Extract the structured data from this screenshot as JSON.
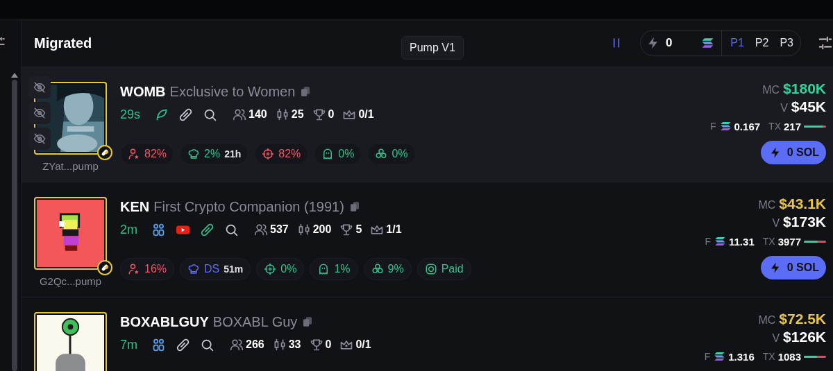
{
  "header": {
    "title": "Migrated",
    "tooltip": "Pump V1",
    "quick_buy": {
      "amount": "0"
    },
    "presets": [
      {
        "label": "P1",
        "selected": true
      },
      {
        "label": "P2",
        "selected": false
      },
      {
        "label": "P3",
        "selected": false
      }
    ]
  },
  "rows": [
    {
      "hovered": true,
      "ticker": "WOMB",
      "name": "Exclusive to Women",
      "address": "ZYat...pump",
      "age": "29s",
      "links": [
        {
          "kind": "feather",
          "highlighted": true
        },
        {
          "kind": "link",
          "highlighted": false
        },
        {
          "kind": "search",
          "highlighted": false
        }
      ],
      "stats": [
        {
          "kind": "holders",
          "value": "140"
        },
        {
          "kind": "candles",
          "value": "25"
        },
        {
          "kind": "trophy",
          "value": "0"
        },
        {
          "kind": "crown",
          "value": "0/1"
        }
      ],
      "badges": [
        {
          "kind": "top_holders",
          "value": "82%",
          "color": "#f0566a"
        },
        {
          "kind": "dev",
          "value": "2%",
          "extra": "21h",
          "color": "#2fc18c"
        },
        {
          "kind": "snipers",
          "value": "82%",
          "color": "#f0566a"
        },
        {
          "kind": "insiders",
          "value": "0%",
          "color": "#2fc18c"
        },
        {
          "kind": "bundles",
          "value": "0%",
          "color": "#2fc18c"
        }
      ],
      "market_cap": {
        "label": "MC",
        "value": "$180K",
        "color": "#2fd39c"
      },
      "volume_label": "V",
      "volume": "$45K",
      "fees_label": "F",
      "tx_label": "TX",
      "fees": "0.167",
      "tx": "217",
      "tx_buy": {
        "level": 0.88
      },
      "buy_label": "0 SOL"
    },
    {
      "hovered": false,
      "ticker": "KEN",
      "name": "First Crypto Companion (1991)",
      "address": "G2Qc...pump",
      "age": "2m",
      "links": [
        {
          "kind": "community",
          "highlighted": false
        },
        {
          "kind": "youtube",
          "highlighted": false
        },
        {
          "kind": "link",
          "highlighted": true
        },
        {
          "kind": "search",
          "highlighted": false
        }
      ],
      "stats": [
        {
          "kind": "holders",
          "value": "537"
        },
        {
          "kind": "candles",
          "value": "200"
        },
        {
          "kind": "trophy",
          "value": "5"
        },
        {
          "kind": "crown",
          "value": "1/1"
        }
      ],
      "badges": [
        {
          "kind": "top_holders",
          "value": "16%",
          "color": "#f0566a"
        },
        {
          "kind": "dev",
          "value": "DS",
          "extra": "51m",
          "color": "#5b6cf5"
        },
        {
          "kind": "snipers",
          "value": "0%",
          "color": "#2fc18c"
        },
        {
          "kind": "insiders",
          "value": "1%",
          "color": "#2fc18c"
        },
        {
          "kind": "bundles",
          "value": "9%",
          "color": "#2fc18c"
        },
        {
          "kind": "paid",
          "value": "Paid",
          "color": "#2fc18c"
        }
      ],
      "market_cap": {
        "label": "MC",
        "value": "$43.1K",
        "color": "#e8c547"
      },
      "volume_label": "V",
      "volume": "$173K",
      "fees_label": "F",
      "tx_label": "TX",
      "fees": "11.31",
      "tx": "3977",
      "tx_buy": {
        "level": 0.62
      },
      "buy_label": "0 SOL"
    },
    {
      "hovered": false,
      "ticker": "BOXABLGUY",
      "name": "BOXABL Guy",
      "age": "7m",
      "links": [
        {
          "kind": "community",
          "highlighted": false
        },
        {
          "kind": "link",
          "highlighted": false
        },
        {
          "kind": "search",
          "highlighted": false
        }
      ],
      "stats": [
        {
          "kind": "holders",
          "value": "266"
        },
        {
          "kind": "candles",
          "value": "33"
        },
        {
          "kind": "trophy",
          "value": "0"
        },
        {
          "kind": "crown",
          "value": "0/1"
        }
      ],
      "market_cap": {
        "label": "MC",
        "value": "$72.5K",
        "color": "#e8c547"
      },
      "volume_label": "V",
      "volume": "$126K",
      "fees_label": "F",
      "tx_label": "TX",
      "fees": "1.316",
      "tx": "1083",
      "tx_buy": {
        "level": 0.6
      }
    }
  ]
}
